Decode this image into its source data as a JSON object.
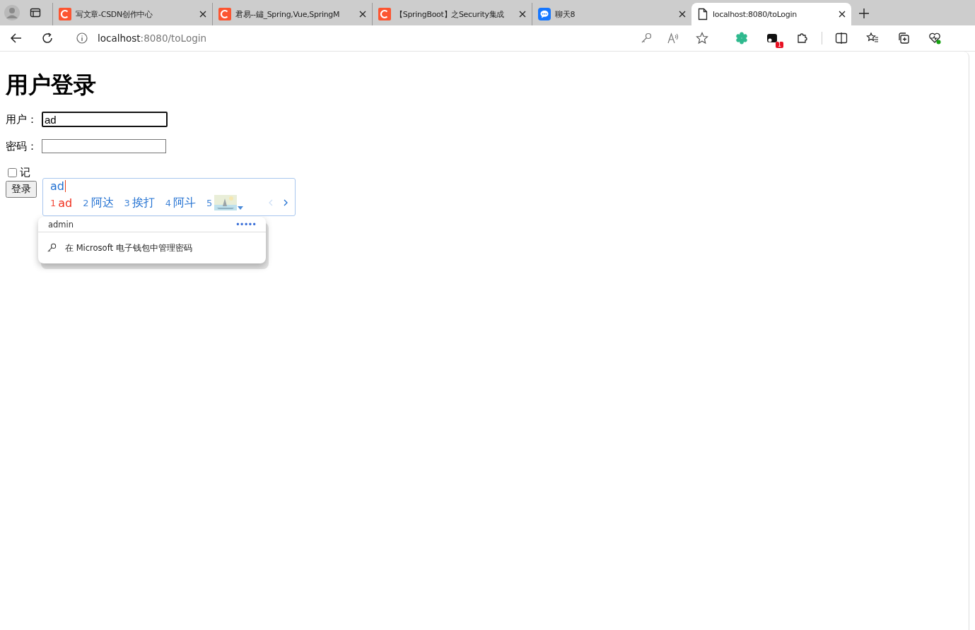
{
  "tabs": [
    {
      "title": "写文章-CSDN创作中心",
      "kind": "csdn",
      "selected": false
    },
    {
      "title": "君易--鏽_Spring,Vue,SpringM",
      "kind": "csdn",
      "selected": false
    },
    {
      "title": "【SpringBoot】之Security集成",
      "kind": "csdn",
      "selected": false
    },
    {
      "title": "聊天8",
      "kind": "chat",
      "selected": false
    },
    {
      "title": "localhost:8080/toLogin",
      "kind": "page",
      "selected": true
    }
  ],
  "address_bar": {
    "host": "localhost",
    "path": ":8080/toLogin"
  },
  "extension_badge": "1",
  "page": {
    "heading": "用户登录",
    "fields": [
      {
        "label": "用户：",
        "kind": "text",
        "value": "ad"
      },
      {
        "label": "密码：",
        "kind": "password"
      }
    ],
    "remember": {
      "label": "记",
      "checked": false
    },
    "submit": "登录"
  },
  "autofill": {
    "username": "admin",
    "password": "•••••",
    "manage": "在 Microsoft 电子钱包中管理密码"
  },
  "ime": {
    "composition": "ad",
    "candidates": [
      {
        "index": "1",
        "text": "ad",
        "selected": true,
        "kind": "text"
      },
      {
        "index": "2",
        "text": "阿达",
        "selected": false,
        "kind": "text"
      },
      {
        "index": "3",
        "text": "挨打",
        "selected": false,
        "kind": "text"
      },
      {
        "index": "4",
        "text": "阿斗",
        "selected": false,
        "kind": "text"
      },
      {
        "index": "5",
        "selected": false,
        "kind": "picture"
      }
    ]
  }
}
